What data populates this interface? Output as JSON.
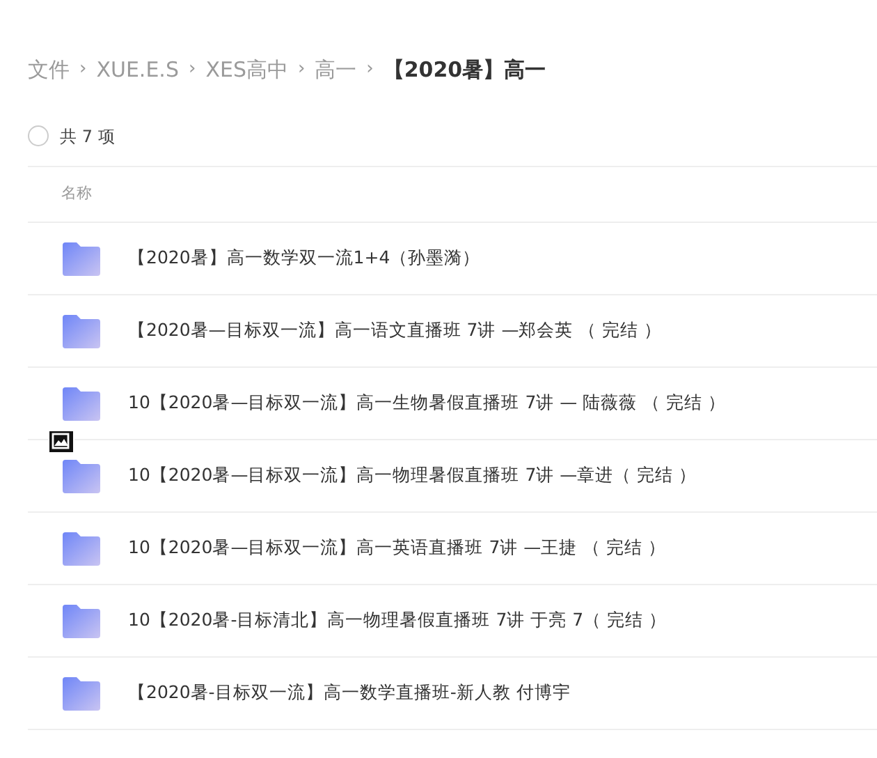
{
  "breadcrumb": [
    {
      "label": "文件",
      "current": false
    },
    {
      "label": "XUE.E.S",
      "current": false
    },
    {
      "label": "XES高中",
      "current": false
    },
    {
      "label": "高一",
      "current": false
    },
    {
      "label": "【2020暑】高一",
      "current": true
    }
  ],
  "breadcrumb_separator": "›",
  "select_all": {
    "checked": false,
    "label": "共 7 项"
  },
  "table": {
    "columns": [
      "名称"
    ],
    "rows": [
      {
        "name": "【2020暑】高一数学双一流1+4（孙墨漪）"
      },
      {
        "name": "【2020暑—目标双一流】高一语文直播班 7讲 —郑会英 （ 完结 ）"
      },
      {
        "name": "10【2020暑—目标双一流】高一生物暑假直播班 7讲 — 陆薇薇 （ 完结 ）"
      },
      {
        "name": "10【2020暑—目标双一流】高一物理暑假直播班 7讲 —章进（ 完结 ）",
        "overlay_icon": true
      },
      {
        "name": "10【2020暑—目标双一流】高一英语直播班 7讲 —王捷 （ 完结 ）"
      },
      {
        "name": "10【2020暑-目标清北】高一物理暑假直播班 7讲 于亮 7（ 完结 ）"
      },
      {
        "name": "【2020暑-目标双一流】高一数学直播班-新人教 付博宇"
      }
    ]
  }
}
